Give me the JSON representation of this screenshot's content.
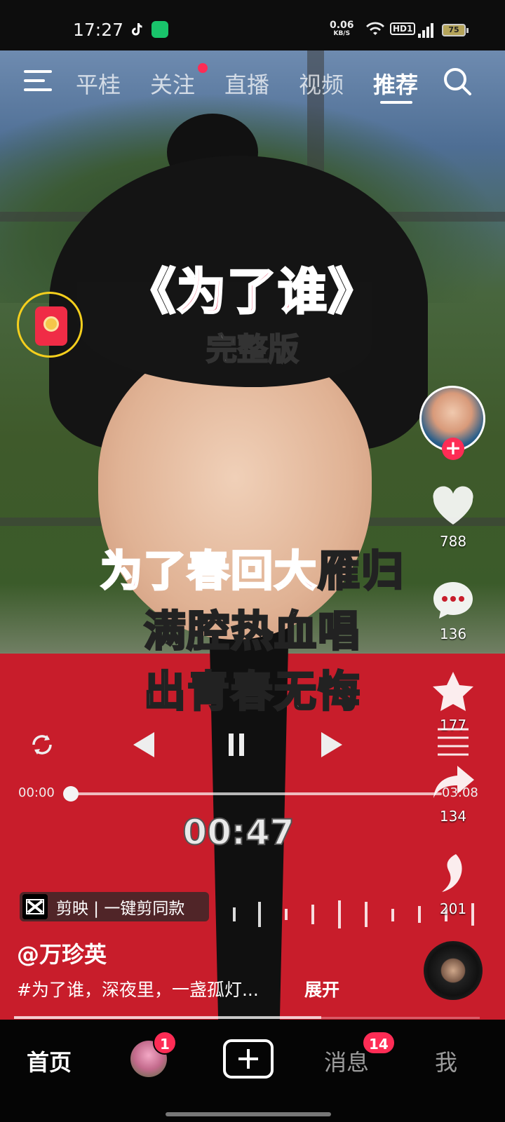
{
  "status_bar": {
    "time": "17:27",
    "net_speed": "0.06",
    "net_unit": "KB/S",
    "hd_label": "HD1",
    "battery": "75",
    "icons": [
      "tiktok-icon",
      "app-icon",
      "wifi-icon",
      "signal-icon",
      "battery-icon"
    ]
  },
  "top_nav": {
    "tabs": [
      {
        "label": "平桂",
        "active": false
      },
      {
        "label": "关注",
        "active": false,
        "dot": true
      },
      {
        "label": "直播",
        "active": false
      },
      {
        "label": "视频",
        "active": false
      },
      {
        "label": "推荐",
        "active": true
      }
    ]
  },
  "video": {
    "title": "《为了谁》",
    "subtitle": "完整版",
    "lyrics": [
      {
        "highlight": "为了春回大",
        "rest": "雁归"
      },
      {
        "highlight": "",
        "rest": "满腔热血唱"
      },
      {
        "highlight": "",
        "rest": "出青春无悔"
      }
    ],
    "player": {
      "start_time": "00:00",
      "end_time": "03:08",
      "current_time": "00:47",
      "progress_fraction": 0.0
    }
  },
  "right_rail": {
    "likes": "788",
    "comments": "136",
    "favorites": "177",
    "shares": "134",
    "extra": "201"
  },
  "bottom_info": {
    "capcut": "剪映 | 一键剪同款",
    "username": "@万珍英",
    "description": "#为了谁，深夜里，一盏孤灯...",
    "expand": "展开",
    "video_progress_fraction": 0.66
  },
  "bottom_nav": {
    "home": "首页",
    "friends_badge": "1",
    "messages": "消息",
    "messages_badge": "14",
    "me": "我"
  },
  "colors": {
    "accent": "#fe2c55",
    "title_red": "#e8214a",
    "redpacket_ring": "#f5cf1d"
  }
}
